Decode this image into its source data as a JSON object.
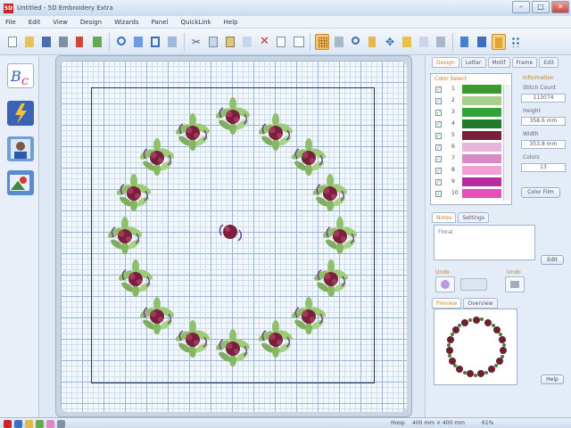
{
  "window": {
    "title": "Untitled - 5D Embroidery Extra",
    "app_logo": "5D",
    "minimize": "–",
    "maximize": "□",
    "close": "✕"
  },
  "menu": [
    "File",
    "Edit",
    "View",
    "Design",
    "Wizards",
    "Panel",
    "QuickLink",
    "Help"
  ],
  "toolbar_icons": [
    "new-icon",
    "open-icon",
    "save-icon",
    "print-icon",
    "import-icon",
    "export-icon",
    "undo-icon",
    "redo-icon",
    "cut-icon",
    "copy-icon",
    "paste-icon",
    "delete-icon",
    "select-icon",
    "grid-icon",
    "zoom-icon",
    "pan-icon",
    "rotate-icon",
    "ruler-icon",
    "hoop-icon",
    "settings-icon"
  ],
  "left_tools": [
    "letters-icon",
    "magic-wand-icon",
    "portrait-icon",
    "picture-icon"
  ],
  "right_panel": {
    "tabs": [
      "Design",
      "Letter",
      "Motif",
      "Frame",
      "Edit"
    ],
    "color_select_label": "Color Select",
    "colors": [
      {
        "num": "1",
        "hex": "#3a9a2e"
      },
      {
        "num": "2",
        "hex": "#a9cf8f"
      },
      {
        "num": "3",
        "hex": "#34a23a"
      },
      {
        "num": "4",
        "hex": "#1f7a2a"
      },
      {
        "num": "5",
        "hex": "#7a1e3c"
      },
      {
        "num": "6",
        "hex": "#e8b4dc"
      },
      {
        "num": "7",
        "hex": "#d988c8"
      },
      {
        "num": "8",
        "hex": "#f2a0d4"
      },
      {
        "num": "9",
        "hex": "#b92ca0"
      },
      {
        "num": "10",
        "hex": "#e64fb4"
      }
    ],
    "information_label": "Information",
    "info": {
      "stitch_count_label": "Stitch Count",
      "stitch_count": "113074",
      "height_label": "Height",
      "height": "358.6 mm",
      "width_label": "Width",
      "width": "353.8 mm",
      "colors_label": "Colors",
      "colors": "13"
    },
    "color_film_button": "Color Film",
    "subtabs": [
      "Notes",
      "Settings"
    ],
    "notes_text": "Floral",
    "edit_button": "Edit",
    "undo_label": "Undo",
    "redo_label": "Undo",
    "preview_tabs": [
      "Preview",
      "Overview"
    ],
    "help_button": "Help"
  },
  "status": {
    "hoop": "Hoop",
    "size": "400 mm × 400 mm",
    "zoom": "61%"
  },
  "accent_color": "#d08a1f"
}
